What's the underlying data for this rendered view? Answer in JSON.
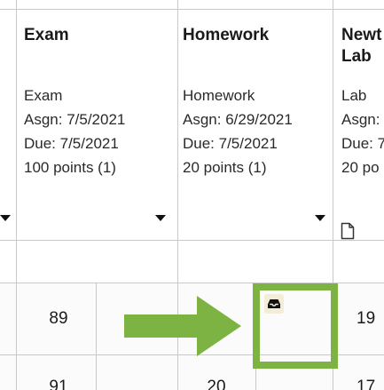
{
  "columns": [
    {
      "title": "Exam",
      "category": "Exam",
      "assigned": "Asgn: 7/5/2021",
      "due": "Due: 7/5/2021",
      "points": "100 points (1)"
    },
    {
      "title": "Homework",
      "category": "Homework",
      "assigned": "Asgn: 6/29/2021",
      "due": "Due: 7/5/2021",
      "points": "20 points (1)"
    },
    {
      "title_line1": "Newt",
      "title_line2": "Lab",
      "category": "Lab",
      "assigned": "Asgn:",
      "due": "Due: 7",
      "points": "20 po"
    }
  ],
  "rows": [
    {
      "exam": "89",
      "homework": "",
      "lab": "19"
    },
    {
      "exam": "91",
      "homework": "20",
      "lab": "17"
    }
  ],
  "icons": {
    "dropdown": "chevron-down-icon",
    "attachment": "document-icon",
    "submission": "inbox-icon",
    "callout": "arrow-right-icon"
  },
  "colors": {
    "highlight": "#7cb342",
    "grid_line": "#c9c9c9",
    "submission_badge": "#f3ecd6"
  }
}
